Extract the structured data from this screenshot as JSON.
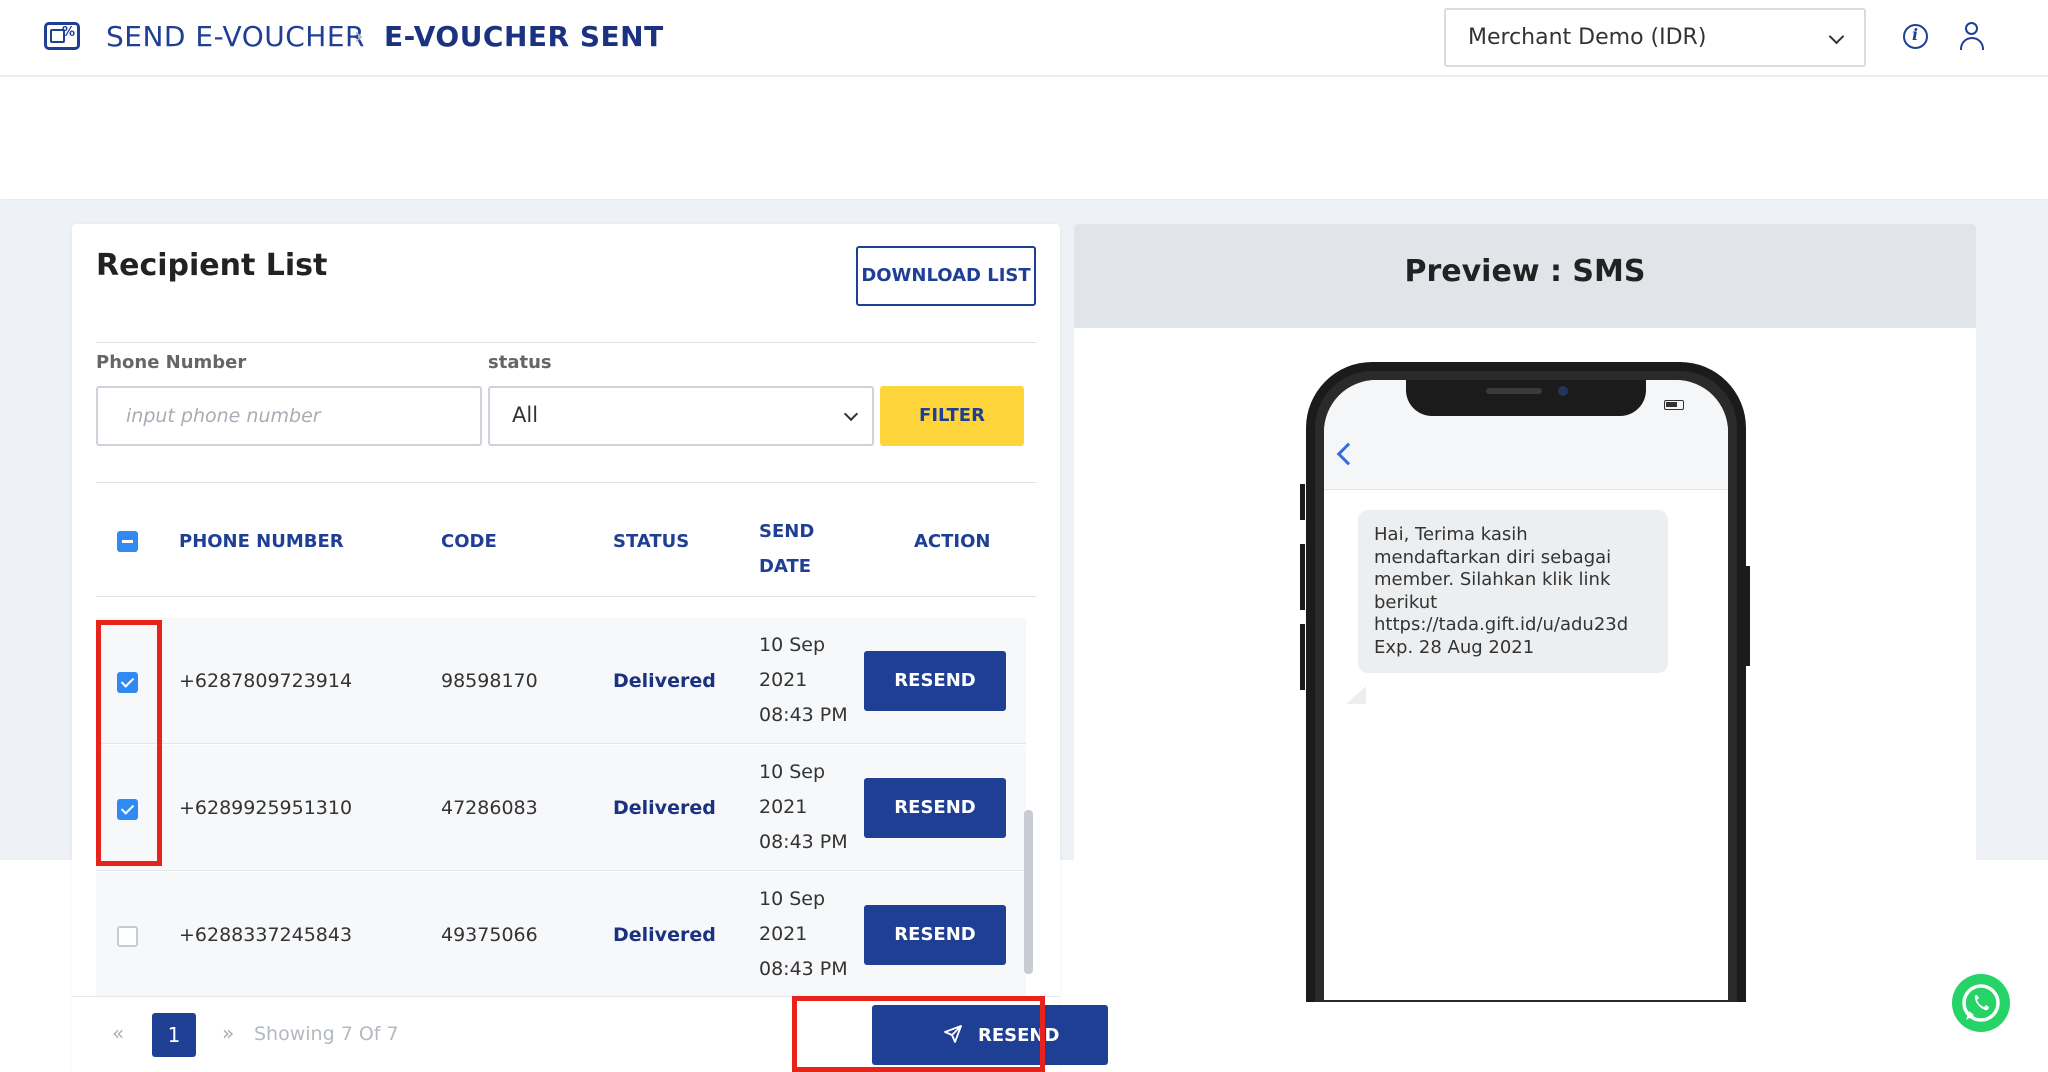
{
  "header": {
    "breadcrumb": [
      "SEND E-VOUCHER",
      "E-VOUCHER SENT"
    ],
    "merchant_select": "Merchant Demo (IDR)",
    "icons": [
      "voucher-logo-icon",
      "info-icon",
      "user-icon"
    ]
  },
  "recipient_list": {
    "title": "Recipient List",
    "download_button": "DOWNLOAD LIST",
    "filters": {
      "phone_label": "Phone Number",
      "phone_placeholder": "input phone number",
      "status_label": "status",
      "status_value": "All",
      "filter_button": "FILTER"
    },
    "columns": [
      "PHONE NUMBER",
      "CODE",
      "STATUS",
      "SEND DATE",
      "ACTION"
    ],
    "rows": [
      {
        "checked": true,
        "phone": "+6287809723914",
        "code": "98598170",
        "status": "Delivered",
        "date": "10 Sep",
        "year": "2021",
        "time": "08:43 PM",
        "action": "RESEND"
      },
      {
        "checked": true,
        "phone": "+6289925951310",
        "code": "47286083",
        "status": "Delivered",
        "date": "10 Sep",
        "year": "2021",
        "time": "08:43 PM",
        "action": "RESEND"
      },
      {
        "checked": false,
        "phone": "+6288337245843",
        "code": "49375066",
        "status": "Delivered",
        "date": "10 Sep",
        "year": "2021",
        "time": "08:43 PM",
        "action": "RESEND"
      }
    ],
    "pagination": {
      "prev": "«",
      "page": "1",
      "next": "»",
      "showing": "Showing 7 Of 7"
    },
    "resend_button": "RESEND"
  },
  "preview": {
    "title": "Preview : SMS",
    "message": "Hai, Terima kasih\nmendaftarkan diri sebagai\nmember. Silahkan klik link\nberikut\nhttps://tada.gift.id/u/adu23d\nExp. 28 Aug 2021"
  },
  "colors": {
    "primary": "#1f3f94",
    "accent_yellow": "#fdd43a",
    "checkbox_blue": "#2f8af2",
    "highlight_red": "#e8231a",
    "whatsapp_green": "#25d366"
  }
}
